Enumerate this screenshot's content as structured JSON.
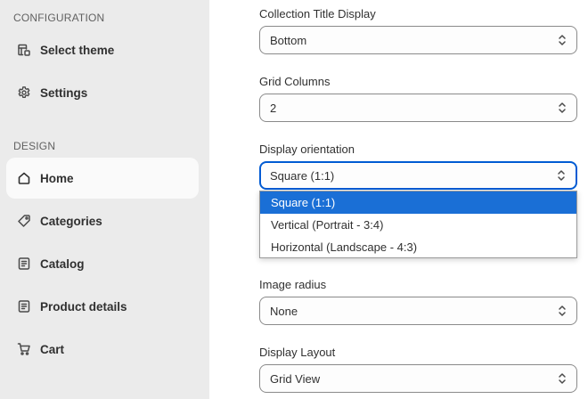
{
  "sidebar": {
    "configuration_heading": "CONFIGURATION",
    "design_heading": "DESIGN",
    "items": [
      {
        "label": "Select theme",
        "icon": "theme-icon"
      },
      {
        "label": "Settings",
        "icon": "gear-icon"
      },
      {
        "label": "Home",
        "icon": "home-icon",
        "active": true
      },
      {
        "label": "Categories",
        "icon": "tag-icon"
      },
      {
        "label": "Catalog",
        "icon": "catalog-icon"
      },
      {
        "label": "Product details",
        "icon": "product-details-icon"
      },
      {
        "label": "Cart",
        "icon": "cart-icon"
      }
    ]
  },
  "form": {
    "collection_title_display": {
      "label": "Collection Title Display",
      "value": "Bottom"
    },
    "grid_columns": {
      "label": "Grid Columns",
      "value": "2"
    },
    "display_orientation": {
      "label": "Display orientation",
      "value": "Square (1:1)",
      "options": [
        "Square (1:1)",
        "Vertical (Portrait - 3:4)",
        "Horizontal (Landscape - 4:3)"
      ],
      "selected_index": 0
    },
    "image_radius": {
      "label": "Image radius",
      "value": "None"
    },
    "display_layout": {
      "label": "Display Layout",
      "value": "Grid View"
    }
  },
  "colors": {
    "sidebar_bg": "#ebebeb",
    "focus_border": "#005bd3",
    "option_highlight": "#1a6fd6"
  }
}
